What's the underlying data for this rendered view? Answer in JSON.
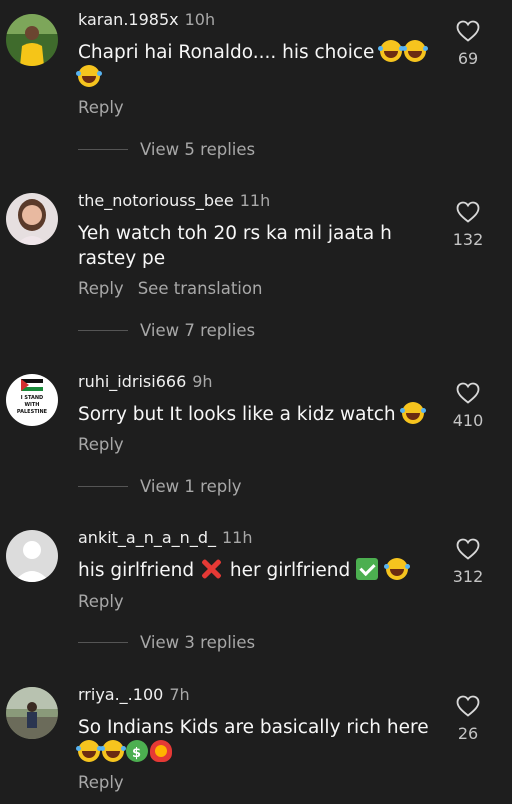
{
  "comments": [
    {
      "username": "karan.1985x",
      "time": "10h",
      "text": "Chapri hai Ronaldo.... his choice",
      "likes": "69",
      "reply": "Reply",
      "view_replies": "View 5 replies",
      "avatar": "person-yellow-shirt-avatar"
    },
    {
      "username": "the_notoriouss_bee",
      "time": "11h",
      "text_line1": "Yeh watch toh 20 rs ka mil jaata h",
      "text_line2": "rastey pe",
      "likes": "132",
      "reply": "Reply",
      "see_translation": "See translation",
      "view_replies": "View 7 replies",
      "avatar": "woman-portrait-avatar"
    },
    {
      "username": "ruhi_idrisi666",
      "time": "9h",
      "text": "Sorry but It looks like a kidz watch",
      "likes": "410",
      "reply": "Reply",
      "view_replies": "View 1 reply",
      "avatar": "i-stand-with-palestine-avatar",
      "avatar_text_1": "I STAND",
      "avatar_text_2": "WITH",
      "avatar_text_3": "PALESTINE"
    },
    {
      "username": "ankit_a_n_a_n_d_",
      "time": "11h",
      "text_part1": "his girlfriend",
      "text_part2": "her girlfriend",
      "likes": "312",
      "reply": "Reply",
      "view_replies": "View 3 replies",
      "avatar": "default-user-avatar"
    },
    {
      "username": "rriya._.100",
      "time": "7h",
      "text": "So Indians Kids are basically rich here",
      "likes": "26",
      "reply": "Reply",
      "avatar": "outdoor-photo-avatar"
    }
  ],
  "icons": {
    "like": "heart-outline-icon"
  },
  "colors": {
    "background": "#1e1e1e",
    "secondary_text": "#a8a8a8",
    "primary_text": "#f5f5f5"
  }
}
